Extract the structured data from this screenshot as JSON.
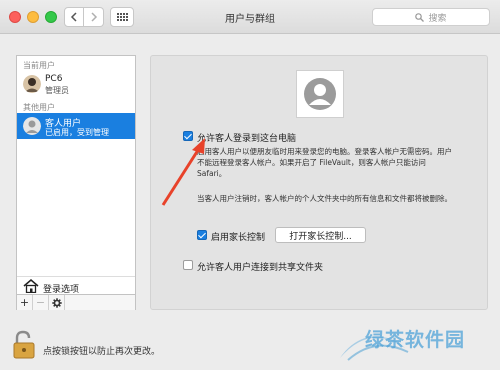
{
  "window": {
    "title": "用户与群组"
  },
  "search": {
    "placeholder": "搜索"
  },
  "sidebar": {
    "current_label": "当前用户",
    "current_user": {
      "name": "PC6",
      "role": "管理员"
    },
    "other_label": "其他用户",
    "guest_user": {
      "name": "客人用户",
      "status": "已启用，受到管理"
    },
    "login_options": "登录选项",
    "tools": [
      "+",
      "−",
      "gear-icon"
    ]
  },
  "main": {
    "allow_guest_login": {
      "label": "允许客人登录到这台电脑",
      "checked": true
    },
    "allow_guest_desc": "启用客人用户以便朋友临时用来登录您的电脑。登录客人帐户无需密码。用户不能远程登录客人帐户。如果开启了 FileVault，则客人帐户只能访问 Safari。",
    "logout_note": "当客人用户注销时，客人帐户的个人文件夹中的所有信息和文件都将被删除。",
    "parental": {
      "label": "启用家长控制",
      "checked": true,
      "button": "打开家长控制..."
    },
    "shared_folders": {
      "label": "允许客人用户连接到共享文件夹",
      "checked": false
    }
  },
  "footer": {
    "lock_text": "点按锁按钮以防止再次更改。"
  },
  "watermark": {
    "text": "绿茶软件园"
  },
  "colors": {
    "selection": "#1a7fe0",
    "arrow": "#e8422a",
    "checkbox": "#1a7fe0"
  }
}
